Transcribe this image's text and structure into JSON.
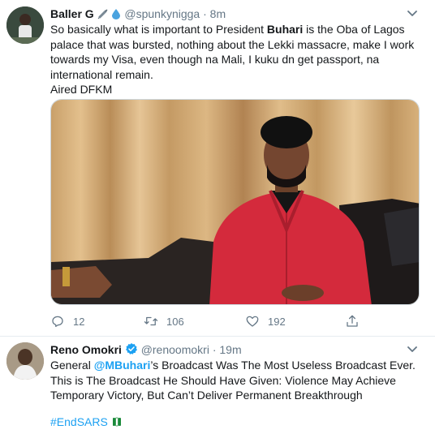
{
  "tweets": [
    {
      "name": "Baller G",
      "handle": "@spunkynigga",
      "separator": "·",
      "time": "8m",
      "text_part1": "So basically what is important to President ",
      "text_bold": "Buhari",
      "text_part2": " is the Oba of Lagos palace that was bursted, nothing about the Lekki massacre, make I work towards my Visa, even though na Mali, I kuku dn get passport, na international remain.\nAired DFKM",
      "replies": "12",
      "retweets": "106",
      "likes": "192",
      "icons": {
        "reply": "reply-icon",
        "retweet": "retweet-icon",
        "like": "heart-icon",
        "share": "share-icon",
        "more": "chevron-down-icon"
      }
    },
    {
      "name": "Reno Omokri",
      "handle": "@renoomokri",
      "separator": "·",
      "time": "19m",
      "text_part1": "General ",
      "mention": "@MBuhari",
      "text_part2": "’s Broadcast Was The Most Useless Broadcast Ever. This is The Broadcast He Should Have Given: Violence May Achieve Temporary Victory, But Can’t Deliver Permanent Breakthrough",
      "hashtag": "#EndSARS",
      "icons": {
        "verified": "verified-badge-icon",
        "more": "chevron-down-icon"
      }
    }
  ],
  "colors": {
    "accent": "#1da1f2",
    "secondary_text": "#657786",
    "primary_text": "#14171a",
    "divider": "#e6ecf0",
    "jacket_red": "#d42a3c"
  }
}
